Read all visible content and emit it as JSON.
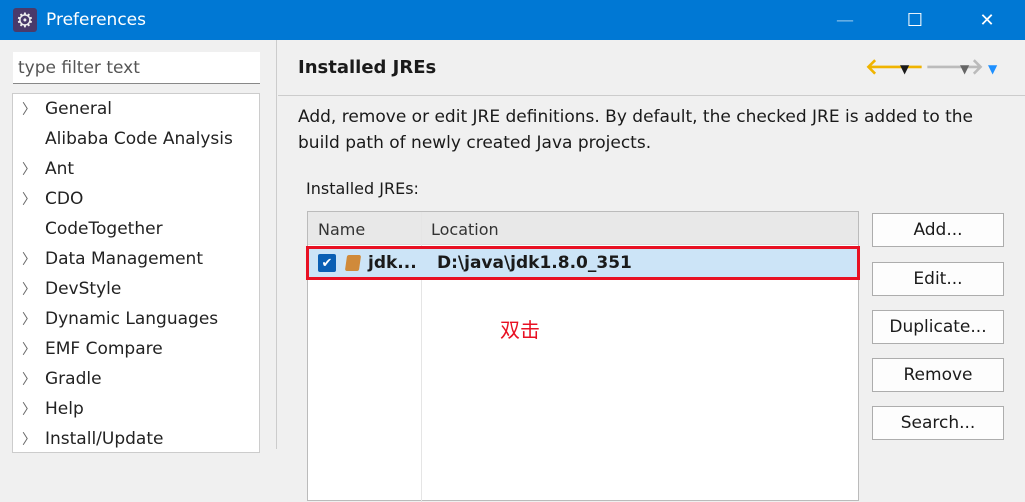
{
  "window": {
    "title": "Preferences",
    "minimize": "—",
    "maximize": "☐",
    "close": "✕"
  },
  "sidebar": {
    "filter_placeholder": "type filter text",
    "items": [
      {
        "label": "General",
        "expandable": true
      },
      {
        "label": "Alibaba Code Analysis",
        "expandable": false
      },
      {
        "label": "Ant",
        "expandable": true
      },
      {
        "label": "CDO",
        "expandable": true
      },
      {
        "label": "CodeTogether",
        "expandable": false
      },
      {
        "label": "Data Management",
        "expandable": true
      },
      {
        "label": "DevStyle",
        "expandable": true
      },
      {
        "label": "Dynamic Languages",
        "expandable": true
      },
      {
        "label": "EMF Compare",
        "expandable": true
      },
      {
        "label": "Gradle",
        "expandable": true
      },
      {
        "label": "Help",
        "expandable": true
      },
      {
        "label": "Install/Update",
        "expandable": true
      }
    ]
  },
  "page": {
    "title": "Installed JREs",
    "description": "Add, remove or edit JRE definitions. By default, the checked JRE is added to the build path of newly created Java projects.",
    "list_label": "Installed JREs:",
    "columns": [
      "Name",
      "Location"
    ],
    "rows": [
      {
        "checked": true,
        "name": "jdk...",
        "location": "D:\\java\\jdk1.8.0_351"
      }
    ],
    "annotation": "双击",
    "buttons": [
      "Add...",
      "Edit...",
      "Duplicate...",
      "Remove",
      "Search..."
    ]
  },
  "colors": {
    "titlebar": "#0078d4",
    "selection": "#cce4f7",
    "highlight": "#e81123",
    "back_arrow": "#f0b400",
    "menu_arrow": "#1e90ff"
  }
}
